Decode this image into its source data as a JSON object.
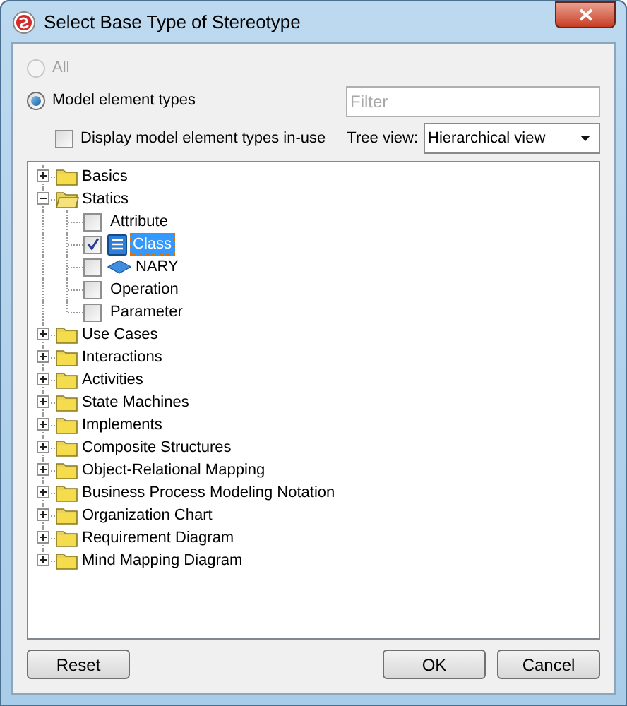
{
  "window": {
    "title": "Select Base Type of Stereotype"
  },
  "scope_options": [
    {
      "label": "All",
      "selected": false,
      "disabled": true
    },
    {
      "label": "Model element types",
      "selected": true,
      "disabled": false
    }
  ],
  "filter": {
    "placeholder": "Filter"
  },
  "in_use_option": {
    "label": "Display model element types in-use",
    "checked": false
  },
  "tree_view": {
    "label": "Tree view:",
    "value": "Hierarchical view"
  },
  "tree": [
    {
      "label": "Basics",
      "expanded": false
    },
    {
      "label": "Statics",
      "expanded": true,
      "children": [
        {
          "label": "Attribute",
          "checked": false,
          "selected": false,
          "kind": "plain"
        },
        {
          "label": "Class",
          "checked": true,
          "selected": true,
          "kind": "class"
        },
        {
          "label": "NARY",
          "checked": false,
          "selected": false,
          "kind": "nary"
        },
        {
          "label": "Operation",
          "checked": false,
          "selected": false,
          "kind": "plain"
        },
        {
          "label": "Parameter",
          "checked": false,
          "selected": false,
          "kind": "plain"
        }
      ]
    },
    {
      "label": "Use Cases",
      "expanded": false
    },
    {
      "label": "Interactions",
      "expanded": false
    },
    {
      "label": "Activities",
      "expanded": false
    },
    {
      "label": "State Machines",
      "expanded": false
    },
    {
      "label": "Implements",
      "expanded": false
    },
    {
      "label": "Composite Structures",
      "expanded": false
    },
    {
      "label": "Object-Relational Mapping",
      "expanded": false
    },
    {
      "label": "Business Process Modeling Notation",
      "expanded": false
    },
    {
      "label": "Organization Chart",
      "expanded": false
    },
    {
      "label": "Requirement Diagram",
      "expanded": false
    },
    {
      "label": "Mind Mapping Diagram",
      "expanded": false
    }
  ],
  "buttons": [
    {
      "label": "Reset"
    },
    {
      "label": "OK"
    },
    {
      "label": "Cancel"
    }
  ]
}
